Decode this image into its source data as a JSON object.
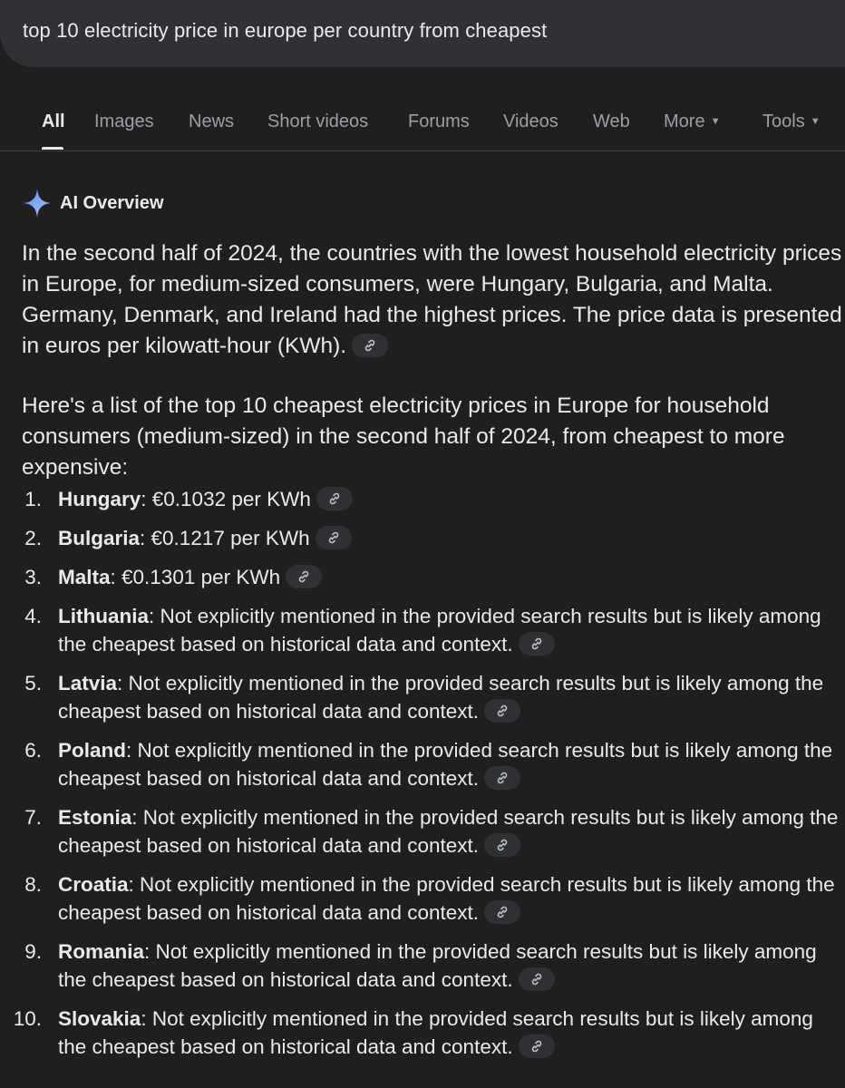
{
  "search": {
    "query": "top 10 electricity price in europe per country from cheapest"
  },
  "tabs": [
    {
      "label": "All"
    },
    {
      "label": "Images"
    },
    {
      "label": "News"
    },
    {
      "label": "Short videos"
    },
    {
      "label": "Forums"
    },
    {
      "label": "Videos"
    },
    {
      "label": "Web"
    },
    {
      "label": "More"
    },
    {
      "label": "Tools"
    }
  ],
  "ai_overview": {
    "label": "AI Overview",
    "paragraph1": "In the second half of 2024, the countries with the lowest household electricity prices in Europe, for medium-sized consumers, were Hungary, Bulgaria, and Malta. Germany, Denmark, and Ireland had the highest prices. The price data is presented in euros per kilowatt-hour (KWh).",
    "paragraph2": "Here's a list of the top 10 cheapest electricity prices in Europe for household consumers (medium-sized) in the second half of 2024, from cheapest to more expensive:",
    "items": [
      {
        "num": "1.",
        "country": "Hungary",
        "text": ": €0.1032 per KWh"
      },
      {
        "num": "2.",
        "country": "Bulgaria",
        "text": ": €0.1217 per KWh"
      },
      {
        "num": "3.",
        "country": "Malta",
        "text": ": €0.1301 per KWh"
      },
      {
        "num": "4.",
        "country": "Lithuania",
        "text": ": Not explicitly mentioned in the provided search results but is likely among the cheapest based on historical data and context."
      },
      {
        "num": "5.",
        "country": "Latvia",
        "text": ": Not explicitly mentioned in the provided search results but is likely among the cheapest based on historical data and context."
      },
      {
        "num": "6.",
        "country": "Poland",
        "text": ": Not explicitly mentioned in the provided search results but is likely among the cheapest based on historical data and context."
      },
      {
        "num": "7.",
        "country": "Estonia",
        "text": ": Not explicitly mentioned in the provided search results but is likely among the cheapest based on historical data and context."
      },
      {
        "num": "8.",
        "country": "Croatia",
        "text": ": Not explicitly mentioned in the provided search results but is likely among the cheapest based on historical data and context."
      },
      {
        "num": "9.",
        "country": "Romania",
        "text": ": Not explicitly mentioned in the provided search results but is likely among the cheapest based on historical data and context."
      },
      {
        "num": "10.",
        "country": "Slovakia",
        "text": ": Not explicitly mentioned in the provided search results but is likely among the cheapest based on historical data and context."
      }
    ]
  },
  "icons": {
    "sparkle": "sparkle-icon",
    "link": "link-icon",
    "caret": "caret-down-icon"
  },
  "colors": {
    "background": "#1f1f1f",
    "search_bar": "#303134",
    "text": "#e8eaed",
    "muted": "#9aa0a6",
    "sparkle_start": "#4c8df6",
    "sparkle_end": "#b4c9f7"
  }
}
